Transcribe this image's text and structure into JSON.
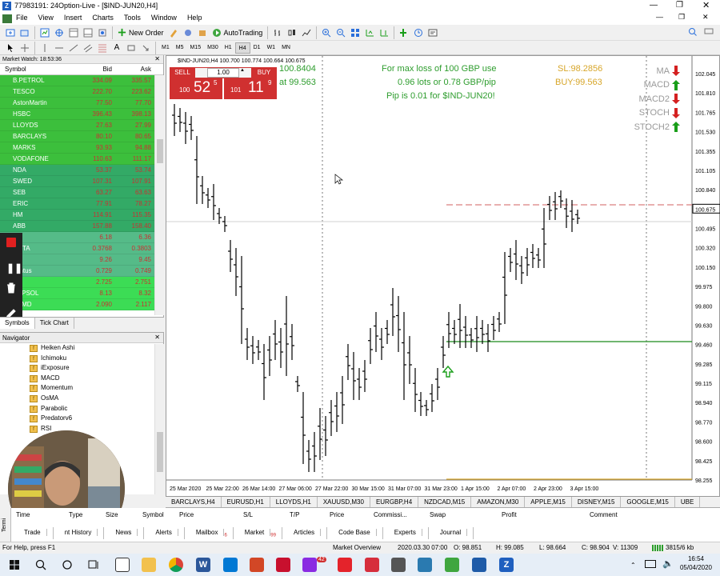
{
  "window": {
    "title": "77983191: 24Option-Live - [$IND-JUN20,H4]"
  },
  "menu": [
    "File",
    "View",
    "Insert",
    "Charts",
    "Tools",
    "Window",
    "Help"
  ],
  "toolbar": {
    "new_order": "New Order",
    "autotrading": "AutoTrading"
  },
  "timeframes": [
    "M1",
    "M5",
    "M15",
    "M30",
    "H1",
    "H4",
    "D1",
    "W1",
    "MN"
  ],
  "active_timeframe": "H4",
  "market_watch": {
    "title": "Market Watch: 18:53:36",
    "col_symbol": "Symbol",
    "col_bid": "Bid",
    "col_ask": "Ask",
    "rows": [
      {
        "symbol": "B.PETROL",
        "bid": "334.09",
        "ask": "335.57",
        "color": "#3cbf3c"
      },
      {
        "symbol": "TESCO",
        "bid": "222.70",
        "ask": "223.62",
        "color": "#3cbf3c"
      },
      {
        "symbol": "AstonMartin",
        "bid": "77.50",
        "ask": "77.70",
        "color": "#3cbf3c"
      },
      {
        "symbol": "HSBC",
        "bid": "396.43",
        "ask": "398.13",
        "color": "#3cbf3c"
      },
      {
        "symbol": "LLOYDS",
        "bid": "27.63",
        "ask": "27.99",
        "color": "#3cbf3c"
      },
      {
        "symbol": "BARCLAYS",
        "bid": "80.10",
        "ask": "80.65",
        "color": "#3cbf3c"
      },
      {
        "symbol": "MARKS",
        "bid": "93.93",
        "ask": "94.88",
        "color": "#3cbf3c"
      },
      {
        "symbol": "VODAFONE",
        "bid": "110.63",
        "ask": "111.17",
        "color": "#3cbf3c"
      },
      {
        "symbol": "NDA",
        "bid": "53.37",
        "ask": "53.74",
        "color": "#33aa66"
      },
      {
        "symbol": "SWED",
        "bid": "107.31",
        "ask": "107.91",
        "color": "#33aa66"
      },
      {
        "symbol": "SEB",
        "bid": "63.27",
        "ask": "63.63",
        "color": "#33aa66"
      },
      {
        "symbol": "ERIC",
        "bid": "77.91",
        "ask": "78.27",
        "color": "#33aa66"
      },
      {
        "symbol": "HM",
        "bid": "114.91",
        "ask": "115.35",
        "color": "#33aa66"
      },
      {
        "symbol": "ABB",
        "bid": "157.88",
        "ask": "158.40",
        "color": "#33aa66"
      },
      {
        "symbol": "T",
        "bid": "6.18",
        "ask": "6.36",
        "color": "#55bb88"
      },
      {
        "symbol": "ELITA",
        "bid": "0.3768",
        "ask": "0.3803",
        "color": "#55bb88"
      },
      {
        "symbol": "",
        "bid": "9.26",
        "ask": "9.45",
        "color": "#55bb88"
      },
      {
        "symbol": "ventus",
        "bid": "0.729",
        "ask": "0.749",
        "color": "#55bb88"
      },
      {
        "symbol": "VA",
        "bid": "2.725",
        "ask": "2.751",
        "color": "#3cdc55"
      },
      {
        "symbol": "REPSOL",
        "bid": "8.13",
        "ask": "8.32",
        "color": "#3cdc55"
      },
      {
        "symbol": "ANMD",
        "bid": "2.090",
        "ask": "2.117",
        "color": "#3cdc55"
      }
    ],
    "tabs": [
      "Symbols",
      "Tick Chart"
    ]
  },
  "navigator": {
    "title": "Navigator",
    "items": [
      "Heiken Ashi",
      "Ichimoku",
      "iExposure",
      "MACD",
      "Momentum",
      "OsMA",
      "Parabolic",
      "Predatorv6",
      "RSI"
    ]
  },
  "trade_panel": {
    "sell_label": "SELL",
    "buy_label": "BUY",
    "lot": "1.00",
    "sell_small": "100",
    "sell_big": "52",
    "sell_sup": "5",
    "buy_small": "101",
    "buy_big": "11",
    "buy_sup": "9"
  },
  "chart": {
    "header": "$IND-JUN20,H4 100.700 100.774 100.664 100.675",
    "sl_line1": "100.8404",
    "sl_line2": "at 99.563",
    "info1": "For max loss of 100 GBP use",
    "info2": "0.96 lots or 0.78 GBP/pip",
    "info3": "Pip is 0.01 for $IND-JUN20!",
    "sl": "SL:98.2856",
    "buy": "BUY:99.563",
    "indicators": [
      {
        "name": "MA",
        "dir": "down"
      },
      {
        "name": "MACD",
        "dir": "up"
      },
      {
        "name": "MACD2",
        "dir": "down"
      },
      {
        "name": "STOCH",
        "dir": "down"
      },
      {
        "name": "STOCH2",
        "dir": "up"
      }
    ],
    "current_price": "100.675",
    "price_labels": [
      "102.045",
      "101.810",
      "101.765",
      "101.530",
      "101.355",
      "101.105",
      "100.840",
      "100.675",
      "100.495",
      "100.320",
      "100.150",
      "99.975",
      "99.800",
      "99.630",
      "99.460",
      "99.285",
      "99.115",
      "98.940",
      "98.770",
      "98.600",
      "98.425",
      "98.255"
    ],
    "time_labels": [
      "25 Mar 2020",
      "25 Mar 22:00",
      "26 Mar 14:00",
      "27 Mar 06:00",
      "27 Mar 22:00",
      "30 Mar 15:00",
      "31 Mar 07:00",
      "31 Mar 23:00",
      "1 Apr 15:00",
      "2 Apr 07:00",
      "2 Apr 23:00",
      "3 Apr 15:00"
    ]
  },
  "chart_tabs": [
    "BARCLAYS,H4",
    "EURUSD,H1",
    "LLOYDS,H1",
    "XAUUSD,M30",
    "EURGBP,H4",
    "NZDCAD,M15",
    "AMAZON,M30",
    "APPLE,M15",
    "DISNEY,M15",
    "GOOGLE,M15",
    "UBE"
  ],
  "terminal": {
    "columns": [
      "Time",
      "Type",
      "Size",
      "Symbol",
      "Price",
      "S/L",
      "T/P",
      "Price",
      "Commissi...",
      "Swap",
      "Profit",
      "Comment"
    ],
    "tabs": [
      "Trade",
      "nt History",
      "News",
      "Alerts",
      "Mailbox",
      "Market",
      "Articles",
      "Code Base",
      "Experts",
      "Journal"
    ],
    "mailbox_badge": "6",
    "market_badge": "99"
  },
  "status": {
    "help": "For Help, press F1",
    "profile": "Market Overview",
    "datetime": "2020.03.30 07:00",
    "open": "O: 98.851",
    "high": "H: 99.085",
    "low": "L: 98.664",
    "close": "C: 98.904",
    "volume": "V: 11309",
    "traffic": "3815/6 kb"
  },
  "taskbar": {
    "time": "16:54",
    "date": "05/04/2020",
    "badge": "42"
  },
  "colors": {
    "accent": "#2a6fdb",
    "sell": "#c0392b",
    "up": "#1a9e1a",
    "down": "#d42020",
    "info": "#2e9d2e",
    "sl": "#d7a62a"
  }
}
